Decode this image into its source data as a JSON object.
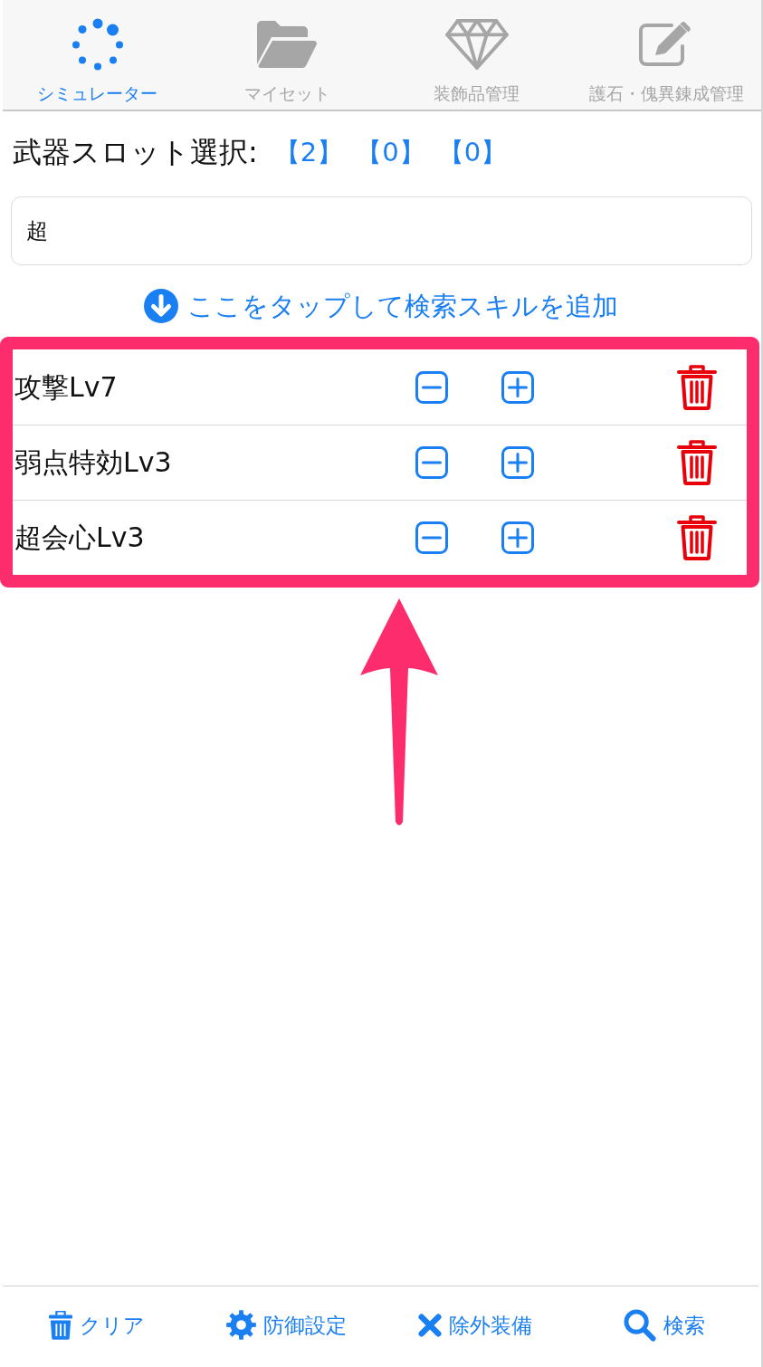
{
  "tabs": [
    {
      "label": "シミュレーター",
      "selected": true,
      "kind": "simulator"
    },
    {
      "label": "マイセット",
      "selected": false,
      "kind": "my-set"
    },
    {
      "label": "装飾品管理",
      "selected": false,
      "kind": "decorations"
    },
    {
      "label": "護石・傀異錬成管理",
      "selected": false,
      "kind": "talismans"
    }
  ],
  "weapon_slots": {
    "label": "武器スロット選択:",
    "slots": [
      "【2】",
      "【0】",
      "【0】"
    ]
  },
  "search": {
    "value": "超"
  },
  "add_skill_link": "ここをタップして検索スキルを追加",
  "skills": [
    "攻撃Lv7",
    "弱点特効Lv3",
    "超会心Lv3"
  ],
  "bottom_bar": [
    {
      "label": "クリア",
      "kind": "clear"
    },
    {
      "label": "防御設定",
      "kind": "defense"
    },
    {
      "label": "除外装備",
      "kind": "exclude"
    },
    {
      "label": "検索",
      "kind": "search"
    }
  ]
}
